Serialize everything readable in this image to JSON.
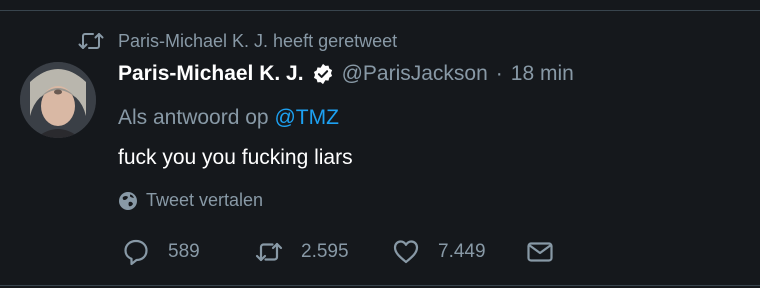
{
  "retweet": {
    "label": "Paris-Michael K. J. heeft geretweet"
  },
  "tweet": {
    "name": "Paris-Michael K. J.",
    "handle": "@ParisJackson",
    "separator": "·",
    "time": "18 min",
    "reply_prefix": "Als antwoord op",
    "reply_mention": "@TMZ",
    "text": "fuck you you fucking liars",
    "translate_label": "Tweet vertalen"
  },
  "actions": {
    "replies": "589",
    "retweets": "2.595",
    "likes": "7.449"
  },
  "colors": {
    "background": "#15181c",
    "muted": "#8899a6",
    "link": "#1da1f2",
    "divider": "#38444d"
  },
  "icons": {
    "retweet": "retweet-icon",
    "verified": "verified-badge-icon",
    "globe": "globe-icon",
    "reply": "reply-icon",
    "like": "heart-icon",
    "dm": "envelope-icon"
  }
}
